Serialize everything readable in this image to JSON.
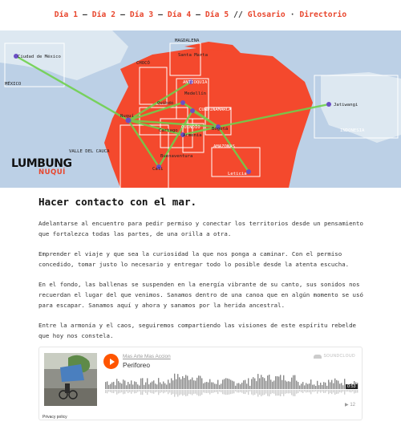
{
  "nav": {
    "items": [
      "Día 1",
      "Día 2",
      "Día 3",
      "Día 4",
      "Día 5",
      "Glosario",
      "Directorio"
    ],
    "sep_dash": " — ",
    "sep_slash": " // ",
    "sep_dot": " · "
  },
  "map": {
    "labels": {
      "ciudad": "Ciudad de México",
      "mexico": "MÉXICO",
      "choco": "CHOCÓ",
      "magdalena": "MAGDALENA",
      "santa_marta": "Santa Marta",
      "antioquia": "ANTIOQUIA",
      "medellin": "Medellín",
      "nuqui": "Nuquí",
      "quibdo": "Quibdó",
      "cartago": "Cartago",
      "cundinamarca": "CUNDINAMARCA",
      "quindio": "QUINDÍO",
      "armenia": "Armenia",
      "bogota": "Bogotá",
      "valle": "VALLE DEL CAUCA",
      "buenaventura": "Buenaventura",
      "cali": "Cali",
      "amazonas": "AMAZONAS",
      "leticia": "Leticia",
      "jatiwangi": "Jatiwangi",
      "indonesia": "INDONESIA"
    },
    "colors": {
      "sea": "#bcd0e6",
      "land": "#f4492d",
      "route": "#6fd04c",
      "node": "#6b4fc4"
    }
  },
  "logo": {
    "line1": "LUMBUNG",
    "line2": "NUQUÍ"
  },
  "article": {
    "title": "Hacer contacto con el mar.",
    "paragraphs": [
      "Adelantarse al encuentro para pedir permiso y conectar los territorios desde un pensamiento que fortalezca todas las partes, de una orilla a otra.",
      "Emprender el viaje y que sea la curiosidad la que nos ponga a caminar. Con el permiso concedido, tomar justo lo necesario y entregar todo lo posible desde la atenta escucha.",
      "En el fondo, las ballenas se suspenden en la energía vibrante de su canto, sus sonidos nos recuerdan el lugar del que venimos. Sanamos dentro de una canoa que en algún momento se usó para escapar. Sanamos aquí y ahora y sanamos por la herida ancestral.",
      "Entre la armonía y el caos, seguiremos compartiendo las visiones de este espíritu rebelde que hoy nos constela."
    ]
  },
  "player": {
    "artist": "Mas Arte Mas Accion",
    "track": "Periforeo",
    "brand": "SOUNDCLOUD",
    "duration": "0:53",
    "plays": "▶ 12",
    "privacy": "Privacy policy"
  }
}
